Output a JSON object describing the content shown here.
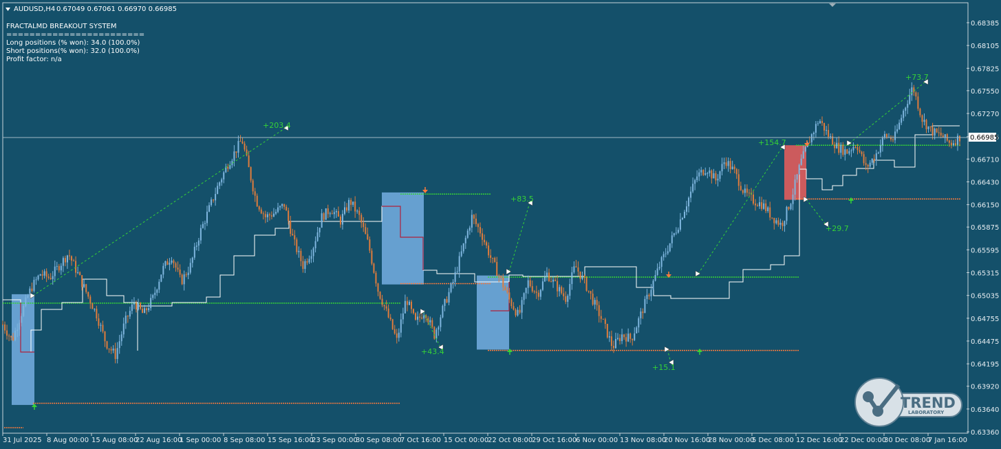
{
  "header": {
    "symbol": "AUDUSD,H4",
    "ohlc": "0.67049 0.67061 0.66970 0.66985",
    "dropdown_icon": "triangle-down-icon"
  },
  "info_panel": {
    "title": "FRACTALMD BREAKOUT SYSTEM",
    "separator": "========================",
    "long_positions": "Long positions (% won): 34.0 (100.0%)",
    "short_positions": "Short positions(% won): 32.0 (100.0%)",
    "profit_factor": "Profit factor: n/a"
  },
  "current_price": "0.66985",
  "colors": {
    "background": "#14506a",
    "bull_candle": "#7fb6df",
    "bear_candle": "#e07c3c",
    "green_signal": "#36d236",
    "orange_level": "#ff7b3b",
    "blue_box": "#6fa8dc",
    "red_box": "#e05c5c",
    "trail_line": "#ffffff",
    "grid_axis_text": "#e8eef2"
  },
  "chart_data": {
    "type": "candlestick",
    "symbol": "AUDUSD",
    "timeframe": "H4",
    "ylim": [
      0.6336,
      0.6851
    ],
    "y_ticks": [
      "0.68385",
      "0.68105",
      "0.67825",
      "0.67550",
      "0.67270",
      "0.66985",
      "0.66710",
      "0.66430",
      "0.66150",
      "0.65875",
      "0.65595",
      "0.65315",
      "0.65035",
      "0.64755",
      "0.64475",
      "0.64195",
      "0.63920",
      "0.63640",
      "0.63360"
    ],
    "x_ticks": [
      "31 Jul 2025",
      "8 Aug 00:00",
      "15 Aug 08:00",
      "22 Aug 16:00",
      "1 Sep 00:00",
      "8 Sep 08:00",
      "15 Sep 16:00",
      "23 Sep 00:00",
      "30 Sep 08:00",
      "7 Oct 16:00",
      "15 Oct 00:00",
      "22 Oct 08:00",
      "29 Oct 16:00",
      "6 Nov 00:00",
      "13 Nov 08:00",
      "20 Nov 16:00",
      "28 Nov 00:00",
      "5 Dec 08:00",
      "12 Dec 16:00",
      "22 Dec 00:00",
      "30 Dec 08:00",
      "7 Jan 16:00"
    ],
    "price_path": [
      [
        0,
        0.6468
      ],
      [
        2,
        0.6448
      ],
      [
        4,
        0.6482
      ],
      [
        6,
        0.6512
      ],
      [
        8,
        0.653
      ],
      [
        10,
        0.6525
      ],
      [
        12,
        0.654
      ],
      [
        14,
        0.6555
      ],
      [
        16,
        0.653
      ],
      [
        18,
        0.6505
      ],
      [
        20,
        0.648
      ],
      [
        22,
        0.6445
      ],
      [
        24,
        0.643
      ],
      [
        26,
        0.647
      ],
      [
        28,
        0.6495
      ],
      [
        30,
        0.648
      ],
      [
        32,
        0.65
      ],
      [
        34,
        0.6535
      ],
      [
        36,
        0.6552
      ],
      [
        38,
        0.652
      ],
      [
        40,
        0.654
      ],
      [
        42,
        0.658
      ],
      [
        44,
        0.661
      ],
      [
        46,
        0.664
      ],
      [
        48,
        0.6665
      ],
      [
        50,
        0.6685
      ],
      [
        51,
        0.6695
      ],
      [
        52,
        0.667
      ],
      [
        54,
        0.662
      ],
      [
        56,
        0.66
      ],
      [
        58,
        0.6605
      ],
      [
        60,
        0.6615
      ],
      [
        62,
        0.657
      ],
      [
        64,
        0.654
      ],
      [
        66,
        0.656
      ],
      [
        68,
        0.66
      ],
      [
        70,
        0.661
      ],
      [
        72,
        0.6595
      ],
      [
        74,
        0.662
      ],
      [
        76,
        0.66
      ],
      [
        78,
        0.6565
      ],
      [
        80,
        0.651
      ],
      [
        82,
        0.648
      ],
      [
        84,
        0.6448
      ],
      [
        86,
        0.65
      ],
      [
        88,
        0.647
      ],
      [
        90,
        0.6485
      ],
      [
        92,
        0.6455
      ],
      [
        94,
        0.649
      ],
      [
        96,
        0.652
      ],
      [
        98,
        0.656
      ],
      [
        100,
        0.66
      ],
      [
        102,
        0.658
      ],
      [
        104,
        0.655
      ],
      [
        106,
        0.6525
      ],
      [
        108,
        0.6498
      ],
      [
        110,
        0.6478
      ],
      [
        112,
        0.652
      ],
      [
        114,
        0.6505
      ],
      [
        116,
        0.653
      ],
      [
        118,
        0.6515
      ],
      [
        120,
        0.65
      ],
      [
        122,
        0.654
      ],
      [
        124,
        0.652
      ],
      [
        126,
        0.6495
      ],
      [
        128,
        0.647
      ],
      [
        130,
        0.644
      ],
      [
        132,
        0.6455
      ],
      [
        134,
        0.645
      ],
      [
        136,
        0.648
      ],
      [
        138,
        0.651
      ],
      [
        140,
        0.654
      ],
      [
        142,
        0.6565
      ],
      [
        144,
        0.659
      ],
      [
        146,
        0.662
      ],
      [
        148,
        0.665
      ],
      [
        150,
        0.666
      ],
      [
        152,
        0.6645
      ],
      [
        154,
        0.667
      ],
      [
        156,
        0.6655
      ],
      [
        158,
        0.663
      ],
      [
        160,
        0.662
      ],
      [
        162,
        0.6615
      ],
      [
        164,
        0.66
      ],
      [
        166,
        0.659
      ],
      [
        168,
        0.662
      ],
      [
        170,
        0.6665
      ],
      [
        172,
        0.6695
      ],
      [
        174,
        0.672
      ],
      [
        176,
        0.67
      ],
      [
        178,
        0.6685
      ],
      [
        180,
        0.668
      ],
      [
        182,
        0.669
      ],
      [
        184,
        0.666
      ],
      [
        186,
        0.6675
      ],
      [
        188,
        0.67
      ],
      [
        190,
        0.6695
      ],
      [
        192,
        0.673
      ],
      [
        194,
        0.676
      ],
      [
        196,
        0.672
      ],
      [
        198,
        0.6705
      ],
      [
        200,
        0.67
      ],
      [
        202,
        0.669
      ],
      [
        204,
        0.6698
      ]
    ],
    "trades": [
      {
        "label": "+203.4",
        "direction": "long"
      },
      {
        "label": "+43.4",
        "direction": "short"
      },
      {
        "label": "+83.5",
        "direction": "long"
      },
      {
        "label": "+15.1",
        "direction": "short"
      },
      {
        "label": "+154.7",
        "direction": "long"
      },
      {
        "label": "+29.7",
        "direction": "short"
      },
      {
        "label": "+73.7",
        "direction": "long"
      }
    ],
    "levels": [
      {
        "price": 0.6494,
        "from": "31 Jul 2025",
        "to": "7 Oct 16:00",
        "kind": "long_entry"
      },
      {
        "price": 0.6371,
        "from": "31 Jul 2025",
        "to": "7 Oct 16:00",
        "kind": "short_entry"
      },
      {
        "price": 0.6628,
        "from": "7 Oct 16:00",
        "to": "15 Oct 00:00",
        "kind": "long_entry"
      },
      {
        "price": 0.6518,
        "from": "7 Oct 16:00",
        "to": "22 Oct 08:00",
        "kind": "short_entry"
      },
      {
        "price": 0.6526,
        "from": "22 Oct 08:00",
        "to": "5 Dec 08:00",
        "kind": "long_entry"
      },
      {
        "price": 0.6436,
        "from": "22 Oct 08:00",
        "to": "5 Dec 08:00",
        "kind": "short_entry"
      },
      {
        "price": 0.6688,
        "from": "12 Dec 16:00",
        "to": "7 Jan 16:00",
        "kind": "long_entry"
      },
      {
        "price": 0.6622,
        "from": "12 Dec 16:00",
        "to": "7 Jan 16:00",
        "kind": "short_entry"
      }
    ]
  },
  "logo": {
    "name": "TREND",
    "sub": "LABORATORY",
    "icon": "trend-laboratory-logo-icon"
  }
}
